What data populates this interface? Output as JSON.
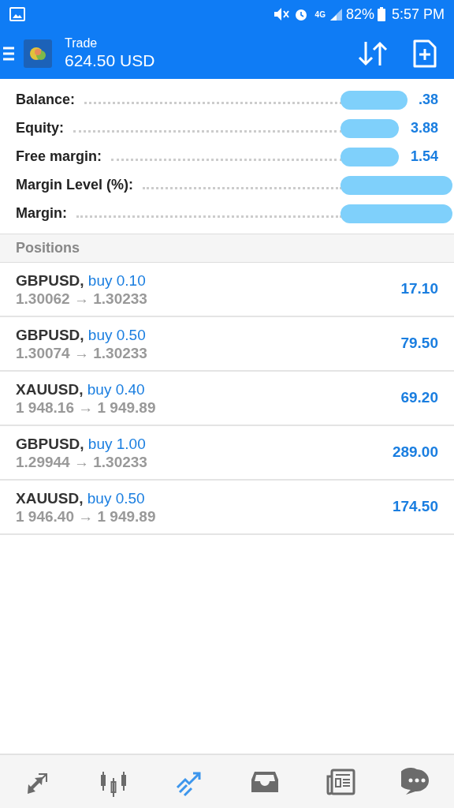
{
  "status_bar": {
    "network": "4G",
    "battery": "82%",
    "time": "5:57 PM"
  },
  "app_bar": {
    "title": "Trade",
    "subtitle": "624.50 USD"
  },
  "summary": [
    {
      "label": "Balance:",
      "value": ".38",
      "redacted": true
    },
    {
      "label": "Equity:",
      "value": "3.88",
      "redacted": true
    },
    {
      "label": "Free margin:",
      "value": "1.54",
      "redacted": true
    },
    {
      "label": "Margin Level (%):",
      "redacted": true
    },
    {
      "label": "Margin:",
      "redacted": true
    }
  ],
  "positions_header": "Positions",
  "positions": [
    {
      "symbol": "GBPUSD,",
      "side": "buy 0.10",
      "prices": "1.30062 → 1.30233",
      "profit": "17.10"
    },
    {
      "symbol": "GBPUSD,",
      "side": "buy 0.50",
      "prices": "1.30074 → 1.30233",
      "profit": "79.50"
    },
    {
      "symbol": "XAUUSD,",
      "side": "buy 0.40",
      "prices": "1 948.16 → 1 949.89",
      "profit": "69.20"
    },
    {
      "symbol": "GBPUSD,",
      "side": "buy 1.00",
      "prices": "1.29944 → 1.30233",
      "profit": "289.00"
    },
    {
      "symbol": "XAUUSD,",
      "side": "buy 0.50",
      "prices": "1 946.40 → 1 949.89",
      "profit": "174.50"
    }
  ],
  "bottom_nav": [
    {
      "kind": "quotes",
      "selected": false
    },
    {
      "kind": "chart",
      "selected": false
    },
    {
      "kind": "trade",
      "selected": true
    },
    {
      "kind": "history",
      "selected": false
    },
    {
      "kind": "news",
      "selected": false
    },
    {
      "kind": "messages",
      "selected": false
    }
  ]
}
